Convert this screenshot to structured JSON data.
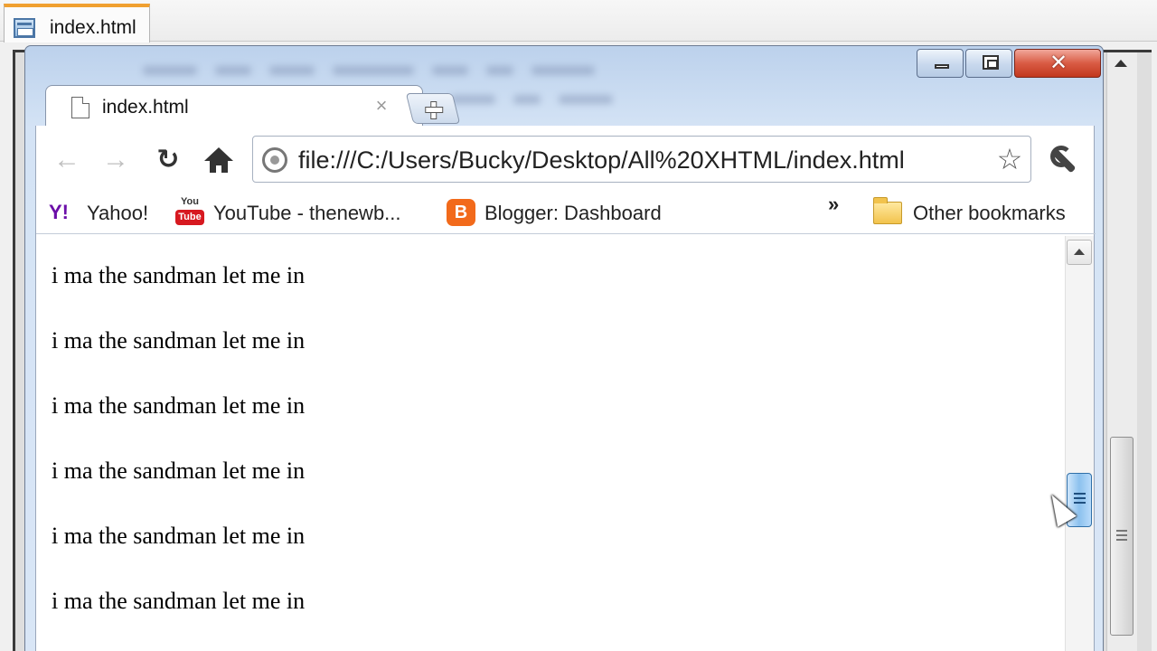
{
  "editor": {
    "tab_label": "index.html"
  },
  "browser": {
    "tab_title": "index.html",
    "tab_close": "×",
    "window_close": "✕",
    "nav": {
      "back": "←",
      "forward": "→",
      "reload": "↻",
      "star": "☆"
    },
    "omnibox": {
      "url": "file:///C:/Users/Bucky/Desktop/All%20XHTML/index.html"
    },
    "bookmarks": {
      "items": [
        {
          "label": "Yahoo!",
          "icon": "yahoo-icon"
        },
        {
          "label": "YouTube - thenewb...",
          "icon": "youtube-icon"
        },
        {
          "label": "Blogger: Dashboard",
          "icon": "blogger-icon"
        }
      ],
      "more": "»",
      "other": "Other bookmarks",
      "youtube_icon_top": "You",
      "youtube_icon_bottom": "Tube",
      "yahoo_icon_glyph": "Y!"
    },
    "content": {
      "lines": [
        "i ma the sandman let me in",
        "i ma the sandman let me in",
        "i ma the sandman let me in",
        "i ma the sandman let me in",
        "i ma the sandman let me in",
        "i ma the sandman let me in"
      ]
    }
  },
  "colors": {
    "editor_tab_accent": "#f0a030",
    "close_button": "#c2371e",
    "scrollbar_thumb": "#8cc1ee",
    "yahoo_purple": "#6b0fa8",
    "youtube_red": "#d71920",
    "blogger_orange": "#f26a1b"
  }
}
